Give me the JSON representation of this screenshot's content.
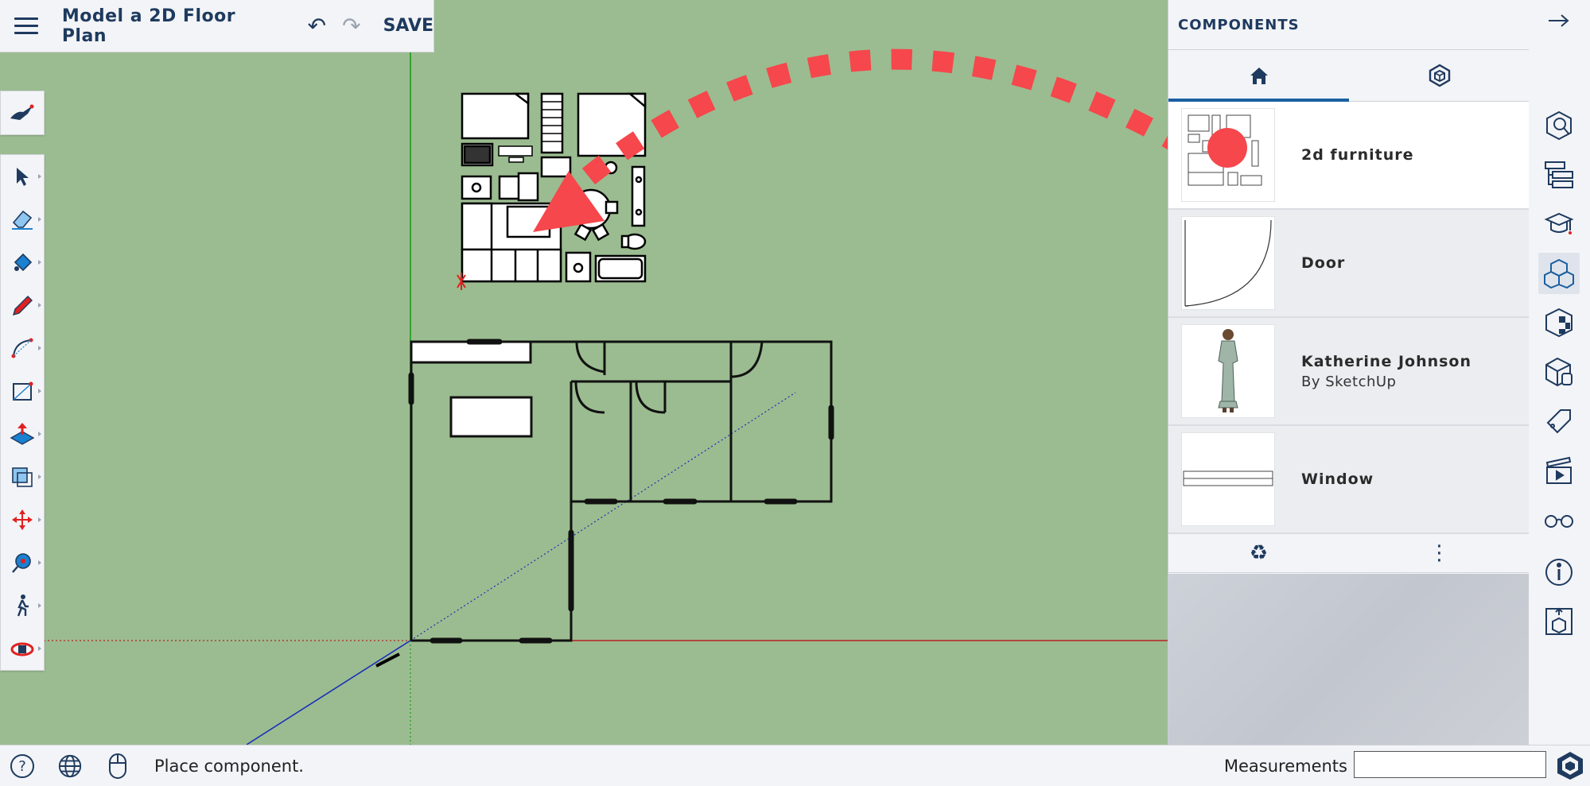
{
  "header": {
    "title": "Model a 2D Floor Plan",
    "save_label": "SAVE",
    "icons": [
      "menu-icon",
      "undo-icon",
      "redo-icon"
    ]
  },
  "tools": [
    "search-scene-icon",
    "select-icon",
    "eraser-icon",
    "paint-bucket-icon",
    "pencil-icon",
    "arc-icon",
    "rectangle-icon",
    "push-pull-icon",
    "offset-icon",
    "move-icon",
    "orbit-icon",
    "walk-icon",
    "rotate-icon"
  ],
  "panel": {
    "title": "COMPONENTS",
    "tabs": [
      "home-icon",
      "3d-warehouse-icon"
    ],
    "components": [
      {
        "name": "2d furniture",
        "sub": ""
      },
      {
        "name": "Door",
        "sub": ""
      },
      {
        "name": "Katherine Johnson",
        "sub": "By SketchUp"
      },
      {
        "name": "Window",
        "sub": ""
      }
    ],
    "footer": [
      "recycle-icon",
      "more-icon"
    ]
  },
  "rail": [
    "entity-info-icon",
    "outliner-icon",
    "instructor-icon",
    "components-icon",
    "materials-icon",
    "styles-icon",
    "tags-icon",
    "scenes-icon",
    "display-icon",
    "info-icon",
    "export-icon"
  ],
  "status": {
    "message": "Place component.",
    "measurements_label": "Measurements",
    "measurements_value": ""
  },
  "colors": {
    "background": "#9bbc90",
    "accent": "#1a5fa0",
    "drag_arrow": "#f5474c"
  }
}
